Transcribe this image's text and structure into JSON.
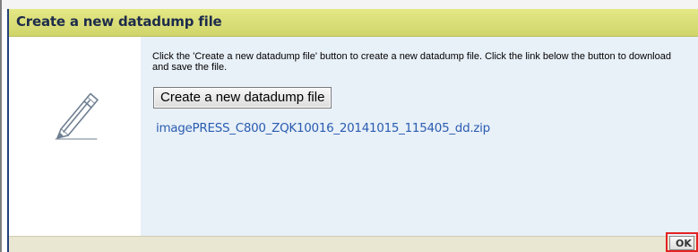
{
  "dialog": {
    "title": "Create a new datadump file",
    "description": "Click the 'Create a new datadump file' button to create a new datadump file. Click the link below the button to download and save the file.",
    "create_button_label": "Create a new datadump file",
    "file_link_text": "imagePRESS_C800_ZQK10016_20141015_115405_dd.zip",
    "ok_label": "OK",
    "icon": "pencil-icon"
  },
  "colors": {
    "title_bar": "#d6db72",
    "title_text": "#1d2b4b",
    "content_bg": "#e8f0f8",
    "link": "#2a5db0",
    "footer": "#e9e6d2",
    "highlight": "#e32222"
  }
}
